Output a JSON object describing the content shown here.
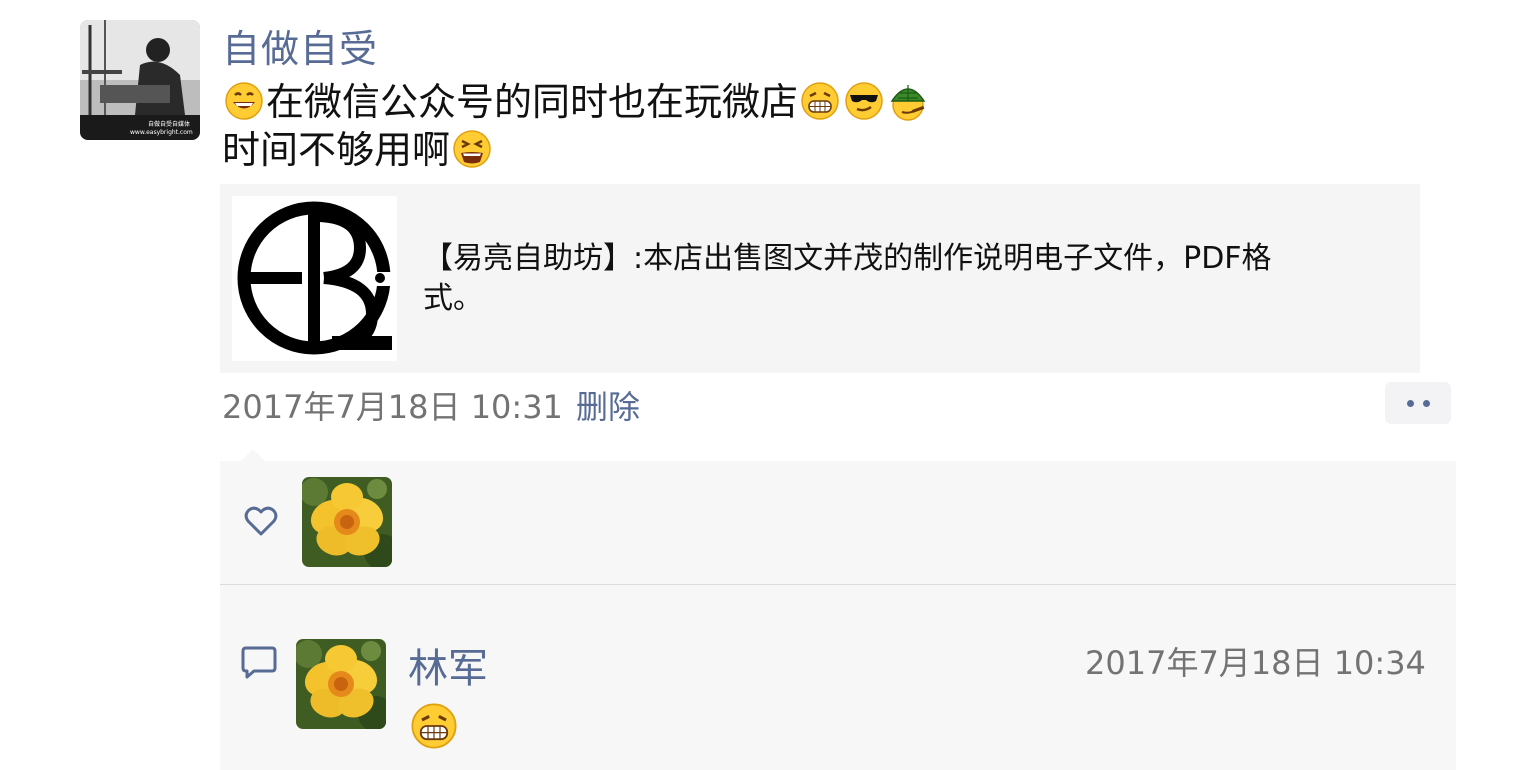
{
  "post": {
    "author": "自做自受",
    "line1": "在微信公众号的同时也在玩微店",
    "line2": "时间不够用啊",
    "emojis_line1_before": [
      "grinning-face"
    ],
    "emojis_line1_after": [
      "beaming-face",
      "sunglasses-face",
      "turtle-hat-face"
    ],
    "emojis_line2_after": [
      "tired-face"
    ],
    "avatar_caption_1": "自做自受自媒体",
    "avatar_caption_2": "www.easybright.com",
    "time": "2017年7月18日 10:31",
    "delete_label": "删除"
  },
  "link_card": {
    "text": "【易亮自助坊】:本店出售图文并茂的制作说明电子文件，PDF格式。",
    "thumb_icon": "eb-logo-icon"
  },
  "likes": {
    "icon": "heart-outline-icon",
    "users": [
      "flower-avatar"
    ]
  },
  "comments": [
    {
      "name": "林军",
      "time": "2017年7月18日 10:34",
      "content_emoji": "beaming-face",
      "icon": "comment-bubble-icon"
    }
  ],
  "colors": {
    "link_blue": "#576b95",
    "time_gray": "#737373",
    "card_bg": "#f5f5f5",
    "interaction_bg": "#f7f7f7"
  }
}
